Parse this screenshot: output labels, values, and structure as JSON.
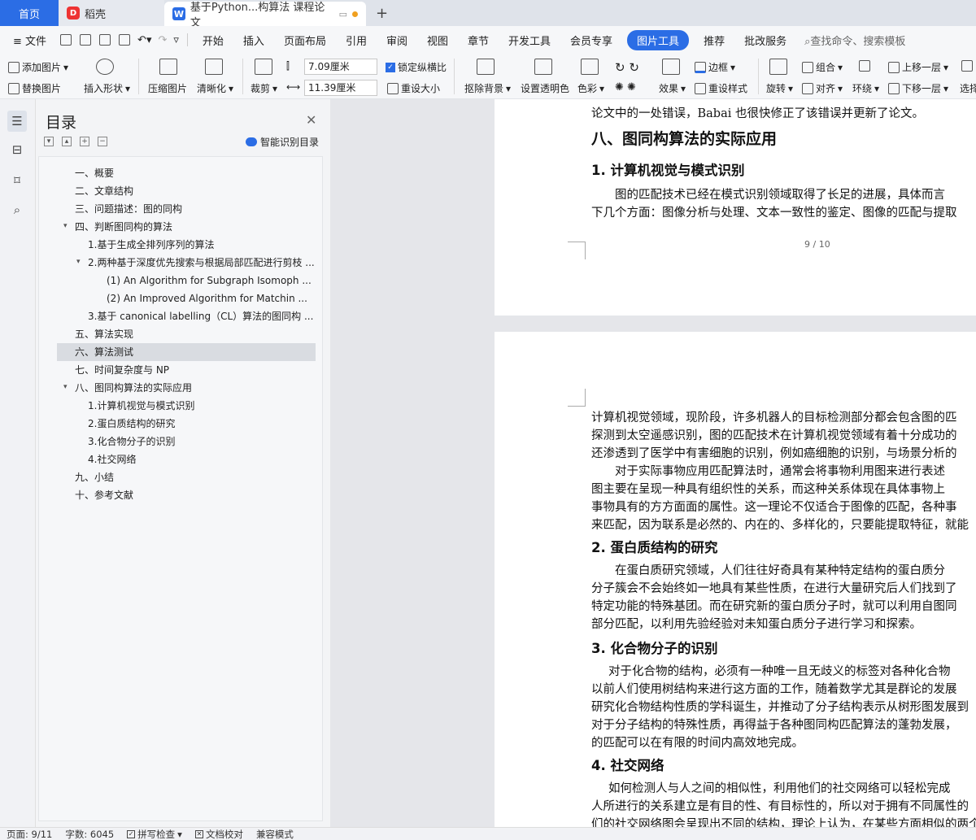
{
  "tabs": {
    "home": "首页",
    "daoke": "稻壳",
    "doc": "基于Python...构算法 课程论文"
  },
  "menu": {
    "file": "文件",
    "items": [
      "开始",
      "插入",
      "页面布局",
      "引用",
      "审阅",
      "视图",
      "章节",
      "开发工具",
      "会员专享",
      "图片工具",
      "推荐",
      "批改服务"
    ],
    "active_index": 9,
    "search": "查找命令、搜索模板"
  },
  "ribbon": {
    "add_image": "添加图片",
    "replace_image": "替换图片",
    "insert_shape": "插入形状",
    "compress": "压缩图片",
    "clarify": "清晰化",
    "crop": "裁剪",
    "height": "7.09厘米",
    "width": "11.39厘米",
    "lock_ratio": "锁定纵横比",
    "reset_size": "重设大小",
    "remove_bg": "抠除背景",
    "set_transparent": "设置透明色",
    "color": "色彩",
    "effect": "效果",
    "border": "边框",
    "reset_style": "重设样式",
    "rotate": "旋转",
    "group": "组合",
    "align": "对齐",
    "wrap": "环绕",
    "bring_forward": "上移一层",
    "send_backward": "下移一层",
    "select": "选择"
  },
  "toc": {
    "title": "目录",
    "smart": "智能识别目录",
    "items": [
      {
        "label": "一、概要"
      },
      {
        "label": "二、文章结构"
      },
      {
        "label": "三、问题描述：图的同构"
      },
      {
        "label": "四、判断图同构的算法"
      },
      {
        "label": "1.基于生成全排列序列的算法"
      },
      {
        "label": "2.两种基于深度优先搜索与根据局部匹配进行剪枝 ..."
      },
      {
        "label": "(1)   An Algorithm for Subgraph Isomoph ..."
      },
      {
        "label": "(2)   An Improved Algorithm for Matchin ..."
      },
      {
        "label": "3.基于 canonical labelling（CL）算法的图同构 ..."
      },
      {
        "label": "五、算法实现"
      },
      {
        "label": "六、算法测试"
      },
      {
        "label": "七、时间复杂度与 NP"
      },
      {
        "label": "八、图同构算法的实际应用"
      },
      {
        "label": "1.计算机视觉与模式识别"
      },
      {
        "label": "2.蛋白质结构的研究"
      },
      {
        "label": "3.化合物分子的识别"
      },
      {
        "label": "4.社交网络"
      },
      {
        "label": "九、小结"
      },
      {
        "label": "十、参考文献"
      }
    ]
  },
  "doc": {
    "p1_line0": "论文中的一处错误，Babai 也很快修正了该错误并更新了论文。",
    "h_section8": "八、图同构算法的实际应用",
    "h_cv": "1. 计算机视觉与模式识别",
    "cv_l1": "图的匹配技术已经在模式识别领域取得了长足的进展，具体而言",
    "cv_l2": "下几个方面：图像分析与处理、文本一致性的鉴定、图像的匹配与提取",
    "page_no": "9 / 10",
    "p2_l1": "计算机视觉领域，现阶段，许多机器人的目标检测部分都会包含图的匹",
    "p2_l2": "探测到太空遥感识别，图的匹配技术在计算机视觉领域有着十分成功的",
    "p2_l3": "还渗透到了医学中有害细胞的识别，例如癌细胞的识别，与场景分析的",
    "p2_l4": "对于实际事物应用匹配算法时，通常会将事物利用图来进行表述",
    "p2_l5": "图主要在呈现一种具有组织性的关系，而这种关系体现在具体事物上",
    "p2_l6": "事物具有的方方面面的属性。这一理论不仅适合于图像的匹配，各种事",
    "p2_l7": "来匹配，因为联系是必然的、内在的、多样化的，只要能提取特征，就能",
    "h_protein": "2. 蛋白质结构的研究",
    "pr_l1": "在蛋白质研究领域，人们往往好奇具有某种特定结构的蛋白质分",
    "pr_l2": "分子簇会不会始终如一地具有某些性质，在进行大量研究后人们找到了",
    "pr_l3": "特定功能的特殊基团。而在研究新的蛋白质分子时，就可以利用自图同",
    "pr_l4": "部分匹配，以利用先验经验对未知蛋白质分子进行学习和探索。",
    "h_chem": "3. 化合物分子的识别",
    "ch_l1": "对于化合物的结构，必须有一种唯一且无歧义的标签对各种化合物",
    "ch_l2": "以前人们使用树结构来进行这方面的工作，随着数学尤其是群论的发展",
    "ch_l3": "研究化合物结构性质的学科诞生，并推动了分子结构表示从树形图发展到",
    "ch_l4": "对于分子结构的特殊性质，再得益于各种图同构匹配算法的蓬勃发展，",
    "ch_l5": "的匹配可以在有限的时间内高效地完成。",
    "h_social": "4. 社交网络",
    "so_l1": "如何检测人与人之间的相似性，利用他们的社交网络可以轻松完成",
    "so_l2": "人所进行的关系建立是有目的性、有目标性的，所以对于拥有不同属性的",
    "so_l3": "们的社交网络图会呈现出不同的结构，理论上认为，在某些方面相似的两个"
  },
  "status": {
    "page": "页面: 9/11",
    "words": "字数: 6045",
    "spell": "拼写检查",
    "proof": "文档校对",
    "compat": "兼容模式"
  }
}
